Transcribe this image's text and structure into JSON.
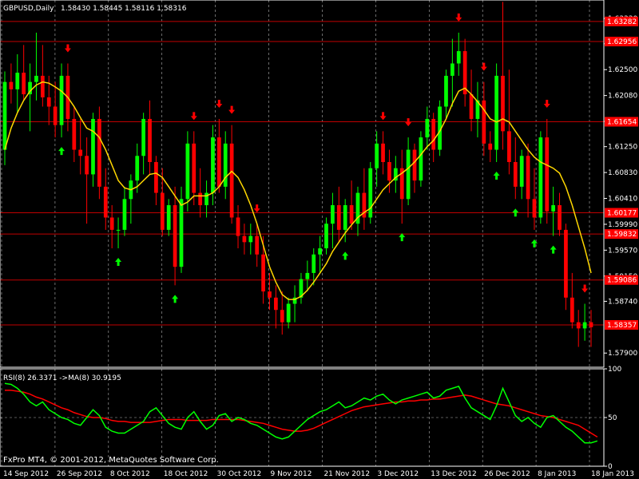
{
  "header": {
    "symbol": "GBPUSD,Daily",
    "ohlc": "1.58430 1.58445 1.58116 1.58316"
  },
  "indicator": {
    "label": "RSI(8) 26.3371 ->MA(8) 30.9195"
  },
  "footer": {
    "copyright": "FxPro MT4, © 2001-2012, MetaQuotes Software Corp."
  },
  "colors": {
    "background": "#000000",
    "bull": "#00ff00",
    "bear": "#ff0000",
    "ma": "#ffd700",
    "rsi": "#00ff00",
    "rsi_ma": "#ff0000",
    "level_line": "#c00000",
    "level_tag": "#ff0000",
    "grid": "#ffffff",
    "text": "#ffffff"
  },
  "chart_data": [
    {
      "type": "candlestick",
      "title": "GBPUSD,Daily",
      "ylim": [
        1.5767,
        1.6363
      ],
      "price_ticks": [
        "1.63330",
        "1.62920",
        "1.62500",
        "1.62080",
        "1.61660",
        "1.61250",
        "1.60830",
        "1.60410",
        "1.59990",
        "1.59570",
        "1.59150",
        "1.58740",
        "1.57900"
      ],
      "date_labels": [
        "14 Sep 2012",
        "26 Sep 2012",
        "8 Oct 2012",
        "18 Oct 2012",
        "30 Oct 2012",
        "9 Nov 2012",
        "21 Nov 2012",
        "3 Dec 2012",
        "13 Dec 2012",
        "26 Dec 2012",
        "8 Jan 2013",
        "18 Jan 2013"
      ],
      "levels": [
        "1.63282",
        "1.62956",
        "1.61654",
        "1.60177",
        "1.59832",
        "1.59086",
        "1.58357"
      ],
      "grid": true,
      "candles": [
        {
          "o": 1.612,
          "h": 1.6247,
          "l": 1.6095,
          "c": 1.623
        },
        {
          "o": 1.623,
          "h": 1.626,
          "l": 1.6195,
          "c": 1.6218
        },
        {
          "o": 1.6218,
          "h": 1.6275,
          "l": 1.618,
          "c": 1.6245
        },
        {
          "o": 1.6245,
          "h": 1.629,
          "l": 1.62,
          "c": 1.621
        },
        {
          "o": 1.621,
          "h": 1.626,
          "l": 1.615,
          "c": 1.623
        },
        {
          "o": 1.623,
          "h": 1.631,
          "l": 1.62,
          "c": 1.624
        },
        {
          "o": 1.624,
          "h": 1.629,
          "l": 1.619,
          "c": 1.6205
        },
        {
          "o": 1.6205,
          "h": 1.624,
          "l": 1.616,
          "c": 1.619
        },
        {
          "o": 1.619,
          "h": 1.623,
          "l": 1.614,
          "c": 1.616
        },
        {
          "o": 1.616,
          "h": 1.626,
          "l": 1.614,
          "c": 1.624
        },
        {
          "o": 1.624,
          "h": 1.626,
          "l": 1.615,
          "c": 1.617
        },
        {
          "o": 1.617,
          "h": 1.619,
          "l": 1.61,
          "c": 1.612
        },
        {
          "o": 1.612,
          "h": 1.617,
          "l": 1.608,
          "c": 1.611
        },
        {
          "o": 1.611,
          "h": 1.614,
          "l": 1.6,
          "c": 1.608
        },
        {
          "o": 1.608,
          "h": 1.618,
          "l": 1.606,
          "c": 1.617
        },
        {
          "o": 1.617,
          "h": 1.619,
          "l": 1.604,
          "c": 1.606
        },
        {
          "o": 1.606,
          "h": 1.609,
          "l": 1.599,
          "c": 1.601
        },
        {
          "o": 1.601,
          "h": 1.603,
          "l": 1.596,
          "c": 1.599
        },
        {
          "o": 1.599,
          "h": 1.601,
          "l": 1.596,
          "c": 1.599
        },
        {
          "o": 1.599,
          "h": 1.606,
          "l": 1.598,
          "c": 1.604
        },
        {
          "o": 1.604,
          "h": 1.608,
          "l": 1.6,
          "c": 1.607
        },
        {
          "o": 1.607,
          "h": 1.613,
          "l": 1.605,
          "c": 1.611
        },
        {
          "o": 1.611,
          "h": 1.618,
          "l": 1.608,
          "c": 1.617
        },
        {
          "o": 1.617,
          "h": 1.62,
          "l": 1.608,
          "c": 1.61
        },
        {
          "o": 1.61,
          "h": 1.611,
          "l": 1.603,
          "c": 1.605
        },
        {
          "o": 1.605,
          "h": 1.609,
          "l": 1.598,
          "c": 1.599
        },
        {
          "o": 1.599,
          "h": 1.604,
          "l": 1.598,
          "c": 1.603
        },
        {
          "o": 1.603,
          "h": 1.606,
          "l": 1.59,
          "c": 1.593
        },
        {
          "o": 1.593,
          "h": 1.606,
          "l": 1.592,
          "c": 1.604
        },
        {
          "o": 1.604,
          "h": 1.615,
          "l": 1.602,
          "c": 1.613
        },
        {
          "o": 1.613,
          "h": 1.615,
          "l": 1.603,
          "c": 1.605
        },
        {
          "o": 1.605,
          "h": 1.609,
          "l": 1.601,
          "c": 1.603
        },
        {
          "o": 1.603,
          "h": 1.607,
          "l": 1.601,
          "c": 1.605
        },
        {
          "o": 1.605,
          "h": 1.616,
          "l": 1.603,
          "c": 1.614
        },
        {
          "o": 1.614,
          "h": 1.617,
          "l": 1.605,
          "c": 1.606
        },
        {
          "o": 1.606,
          "h": 1.615,
          "l": 1.604,
          "c": 1.613
        },
        {
          "o": 1.613,
          "h": 1.616,
          "l": 1.6,
          "c": 1.601
        },
        {
          "o": 1.601,
          "h": 1.603,
          "l": 1.596,
          "c": 1.598
        },
        {
          "o": 1.598,
          "h": 1.6,
          "l": 1.595,
          "c": 1.597
        },
        {
          "o": 1.597,
          "h": 1.6,
          "l": 1.595,
          "c": 1.598
        },
        {
          "o": 1.598,
          "h": 1.6,
          "l": 1.593,
          "c": 1.595
        },
        {
          "o": 1.595,
          "h": 1.598,
          "l": 1.587,
          "c": 1.589
        },
        {
          "o": 1.589,
          "h": 1.592,
          "l": 1.586,
          "c": 1.588
        },
        {
          "o": 1.588,
          "h": 1.59,
          "l": 1.583,
          "c": 1.586
        },
        {
          "o": 1.586,
          "h": 1.589,
          "l": 1.582,
          "c": 1.584
        },
        {
          "o": 1.584,
          "h": 1.588,
          "l": 1.583,
          "c": 1.587
        },
        {
          "o": 1.587,
          "h": 1.59,
          "l": 1.584,
          "c": 1.588
        },
        {
          "o": 1.588,
          "h": 1.592,
          "l": 1.587,
          "c": 1.591
        },
        {
          "o": 1.591,
          "h": 1.594,
          "l": 1.589,
          "c": 1.592
        },
        {
          "o": 1.592,
          "h": 1.596,
          "l": 1.59,
          "c": 1.595
        },
        {
          "o": 1.595,
          "h": 1.598,
          "l": 1.592,
          "c": 1.596
        },
        {
          "o": 1.596,
          "h": 1.601,
          "l": 1.595,
          "c": 1.6
        },
        {
          "o": 1.6,
          "h": 1.605,
          "l": 1.596,
          "c": 1.603
        },
        {
          "o": 1.603,
          "h": 1.606,
          "l": 1.597,
          "c": 1.599
        },
        {
          "o": 1.599,
          "h": 1.604,
          "l": 1.597,
          "c": 1.603
        },
        {
          "o": 1.603,
          "h": 1.607,
          "l": 1.599,
          "c": 1.6
        },
        {
          "o": 1.6,
          "h": 1.606,
          "l": 1.598,
          "c": 1.605
        },
        {
          "o": 1.605,
          "h": 1.609,
          "l": 1.599,
          "c": 1.601
        },
        {
          "o": 1.601,
          "h": 1.61,
          "l": 1.6,
          "c": 1.609
        },
        {
          "o": 1.609,
          "h": 1.615,
          "l": 1.606,
          "c": 1.613
        },
        {
          "o": 1.613,
          "h": 1.615,
          "l": 1.608,
          "c": 1.61
        },
        {
          "o": 1.61,
          "h": 1.612,
          "l": 1.605,
          "c": 1.607
        },
        {
          "o": 1.607,
          "h": 1.611,
          "l": 1.605,
          "c": 1.609
        },
        {
          "o": 1.609,
          "h": 1.612,
          "l": 1.6,
          "c": 1.604
        },
        {
          "o": 1.604,
          "h": 1.614,
          "l": 1.603,
          "c": 1.612
        },
        {
          "o": 1.612,
          "h": 1.613,
          "l": 1.605,
          "c": 1.607
        },
        {
          "o": 1.607,
          "h": 1.615,
          "l": 1.606,
          "c": 1.614
        },
        {
          "o": 1.614,
          "h": 1.619,
          "l": 1.612,
          "c": 1.617
        },
        {
          "o": 1.617,
          "h": 1.618,
          "l": 1.61,
          "c": 1.612
        },
        {
          "o": 1.612,
          "h": 1.62,
          "l": 1.611,
          "c": 1.619
        },
        {
          "o": 1.619,
          "h": 1.625,
          "l": 1.617,
          "c": 1.624
        },
        {
          "o": 1.624,
          "h": 1.63,
          "l": 1.619,
          "c": 1.626
        },
        {
          "o": 1.626,
          "h": 1.631,
          "l": 1.624,
          "c": 1.628
        },
        {
          "o": 1.628,
          "h": 1.63,
          "l": 1.619,
          "c": 1.621
        },
        {
          "o": 1.621,
          "h": 1.625,
          "l": 1.615,
          "c": 1.617
        },
        {
          "o": 1.617,
          "h": 1.623,
          "l": 1.614,
          "c": 1.62
        },
        {
          "o": 1.62,
          "h": 1.623,
          "l": 1.611,
          "c": 1.613
        },
        {
          "o": 1.613,
          "h": 1.615,
          "l": 1.61,
          "c": 1.612
        },
        {
          "o": 1.612,
          "h": 1.626,
          "l": 1.61,
          "c": 1.624
        },
        {
          "o": 1.624,
          "h": 1.636,
          "l": 1.612,
          "c": 1.615
        },
        {
          "o": 1.615,
          "h": 1.625,
          "l": 1.608,
          "c": 1.61
        },
        {
          "o": 1.61,
          "h": 1.614,
          "l": 1.604,
          "c": 1.606
        },
        {
          "o": 1.606,
          "h": 1.612,
          "l": 1.604,
          "c": 1.611
        },
        {
          "o": 1.611,
          "h": 1.613,
          "l": 1.601,
          "c": 1.604
        },
        {
          "o": 1.604,
          "h": 1.609,
          "l": 1.599,
          "c": 1.601
        },
        {
          "o": 1.601,
          "h": 1.615,
          "l": 1.6,
          "c": 1.614
        },
        {
          "o": 1.614,
          "h": 1.617,
          "l": 1.6,
          "c": 1.602
        },
        {
          "o": 1.602,
          "h": 1.606,
          "l": 1.598,
          "c": 1.603
        },
        {
          "o": 1.603,
          "h": 1.605,
          "l": 1.598,
          "c": 1.599
        },
        {
          "o": 1.599,
          "h": 1.6,
          "l": 1.586,
          "c": 1.588
        },
        {
          "o": 1.588,
          "h": 1.592,
          "l": 1.583,
          "c": 1.584
        },
        {
          "o": 1.584,
          "h": 1.586,
          "l": 1.58,
          "c": 1.583
        },
        {
          "o": 1.583,
          "h": 1.587,
          "l": 1.581,
          "c": 1.584
        },
        {
          "o": 1.584,
          "h": 1.586,
          "l": 1.58,
          "c": 1.5832
        }
      ],
      "ma": [
        1.612,
        1.6155,
        1.618,
        1.62,
        1.6215,
        1.6225,
        1.623,
        1.6228,
        1.6222,
        1.6215,
        1.6205,
        1.619,
        1.6172,
        1.6155,
        1.615,
        1.614,
        1.612,
        1.6095,
        1.607,
        1.6058,
        1.6055,
        1.606,
        1.607,
        1.608,
        1.6082,
        1.6075,
        1.606,
        1.6045,
        1.603,
        1.6035,
        1.6045,
        1.6045,
        1.6045,
        1.605,
        1.606,
        1.6075,
        1.6085,
        1.6075,
        1.6055,
        1.603,
        1.6,
        1.5965,
        1.593,
        1.5905,
        1.5885,
        1.5877,
        1.5877,
        1.5882,
        1.5892,
        1.5905,
        1.592,
        1.5935,
        1.5955,
        1.597,
        1.5985,
        1.5998,
        1.601,
        1.6018,
        1.6025,
        1.604,
        1.6055,
        1.6065,
        1.6075,
        1.6082,
        1.609,
        1.61,
        1.6112,
        1.6125,
        1.6135,
        1.615,
        1.617,
        1.6195,
        1.6215,
        1.622,
        1.621,
        1.6198,
        1.6185,
        1.617,
        1.6165,
        1.617,
        1.6165,
        1.615,
        1.6135,
        1.612,
        1.6108,
        1.61,
        1.6095,
        1.609,
        1.6082,
        1.606,
        1.603,
        1.5995,
        1.596,
        1.592
      ]
    },
    {
      "type": "line",
      "title": "RSI(8) 26.3371 ->MA(8) 30.9195",
      "ylim": [
        0,
        100
      ],
      "y_ticks": [
        "100",
        "50",
        "0"
      ],
      "levels": [
        50
      ],
      "series": [
        {
          "name": "RSI(8)",
          "values": [
            85,
            84,
            80,
            74,
            66,
            62,
            66,
            58,
            54,
            50,
            48,
            44,
            42,
            50,
            58,
            52,
            40,
            36,
            34,
            34,
            38,
            42,
            46,
            56,
            60,
            52,
            44,
            40,
            38,
            50,
            56,
            46,
            38,
            42,
            52,
            54,
            46,
            50,
            48,
            44,
            42,
            38,
            34,
            30,
            28,
            30,
            36,
            42,
            48,
            52,
            56,
            58,
            62,
            66,
            60,
            62,
            66,
            70,
            68,
            72,
            74,
            68,
            64,
            68,
            70,
            72,
            74,
            76,
            70,
            72,
            78,
            80,
            82,
            70,
            60,
            56,
            52,
            48,
            62,
            80,
            66,
            52,
            46,
            50,
            44,
            40,
            50,
            52,
            46,
            40,
            36,
            30,
            24,
            24,
            26
          ]
        },
        {
          "name": "MA(8)",
          "values": [
            78,
            78,
            77,
            76,
            74,
            71,
            69,
            66,
            63,
            60,
            58,
            55,
            53,
            51,
            50,
            50,
            49,
            47,
            46,
            46,
            45,
            45,
            45,
            45,
            46,
            47,
            48,
            48,
            48,
            47,
            47,
            47,
            47,
            48,
            48,
            48,
            48,
            48,
            47,
            46,
            45,
            44,
            42,
            40,
            38,
            37,
            36,
            36,
            37,
            39,
            42,
            45,
            48,
            51,
            54,
            57,
            59,
            61,
            62,
            63,
            64,
            65,
            66,
            66,
            67,
            67,
            68,
            68,
            69,
            69,
            70,
            71,
            72,
            73,
            72,
            70,
            68,
            66,
            64,
            63,
            62,
            60,
            58,
            56,
            54,
            52,
            51,
            50,
            48,
            46,
            44,
            42,
            38,
            34,
            30
          ]
        }
      ]
    }
  ]
}
